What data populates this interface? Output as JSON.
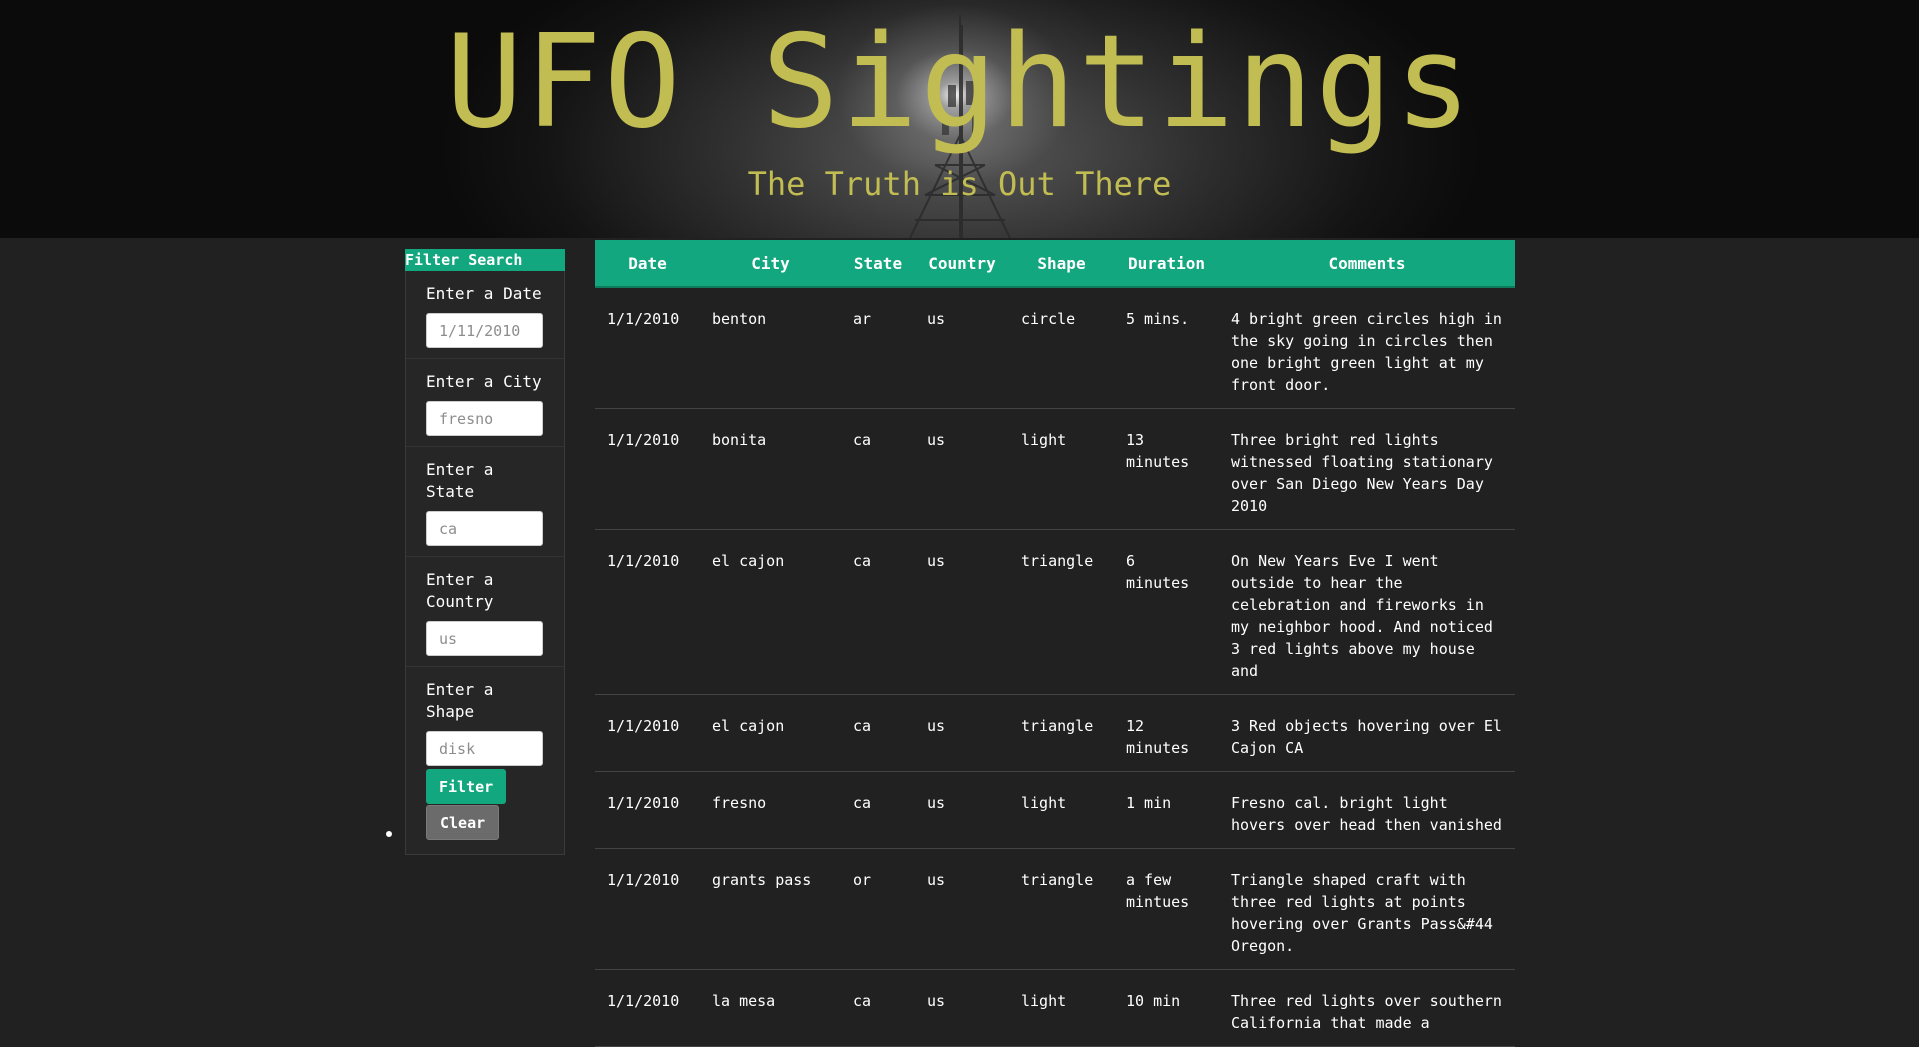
{
  "header": {
    "title": "UFO Sightings",
    "subtitle": "The Truth is Out There"
  },
  "sidebar": {
    "heading": "Filter Search",
    "filters": [
      {
        "label": "Enter a Date",
        "placeholder": "1/11/2010"
      },
      {
        "label": "Enter a City",
        "placeholder": "fresno"
      },
      {
        "label": "Enter a State",
        "placeholder": "ca"
      },
      {
        "label": "Enter a Country",
        "placeholder": "us"
      },
      {
        "label": "Enter a Shape",
        "placeholder": "disk"
      }
    ],
    "filter_button": "Filter",
    "clear_button": "Clear"
  },
  "table": {
    "columns": [
      "Date",
      "City",
      "State",
      "Country",
      "Shape",
      "Duration",
      "Comments"
    ],
    "rows": [
      [
        "1/1/2010",
        "benton",
        "ar",
        "us",
        "circle",
        "5 mins.",
        "4 bright green circles high in the sky going in circles then one bright green light at my front door."
      ],
      [
        "1/1/2010",
        "bonita",
        "ca",
        "us",
        "light",
        "13 minutes",
        "Three bright red lights witnessed floating stationary over San Diego New Years Day 2010"
      ],
      [
        "1/1/2010",
        "el cajon",
        "ca",
        "us",
        "triangle",
        "6 minutes",
        "On New Years Eve I went outside to hear the celebration and fireworks in my neighbor hood. And noticed 3 red lights above my house and"
      ],
      [
        "1/1/2010",
        "el cajon",
        "ca",
        "us",
        "triangle",
        "12 minutes",
        "3 Red objects hovering over El Cajon CA"
      ],
      [
        "1/1/2010",
        "fresno",
        "ca",
        "us",
        "light",
        "1 min",
        "Fresno cal. bright light hovers over head then vanished"
      ],
      [
        "1/1/2010",
        "grants pass",
        "or",
        "us",
        "triangle",
        "a few mintues",
        "Triangle shaped craft with three red lights at points hovering over Grants Pass&#44 Oregon."
      ],
      [
        "1/1/2010",
        "la mesa",
        "ca",
        "us",
        "light",
        "10 min",
        "Three red lights over southern California that made a"
      ]
    ]
  }
}
